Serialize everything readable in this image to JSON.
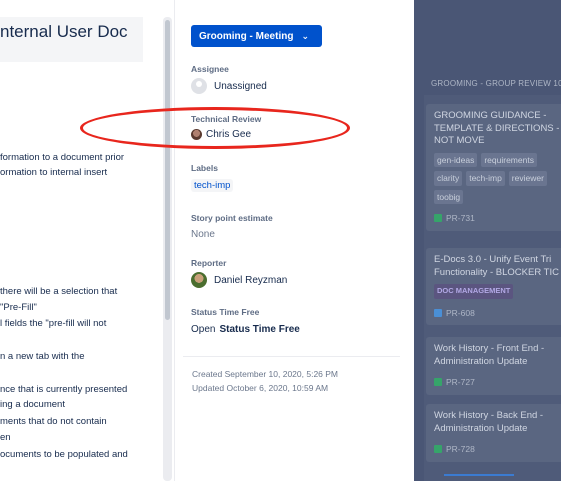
{
  "description": {
    "title": "nternal User Doc",
    "lines": [
      "formation to a document prior",
      "ormation to internal insert",
      "there will be a selection that",
      "\"Pre-Fill\"",
      "l fields the \"pre-fill will not",
      "n a new tab with the",
      "nce that is currently presented",
      "ing a document",
      "ments that do not contain",
      "en",
      "ocuments to be populated and"
    ]
  },
  "details": {
    "status_label": "Grooming - Meeting",
    "assignee_label": "Assignee",
    "assignee_value": "Unassigned",
    "technical_review_label": "Technical Review",
    "technical_review_value": "Chris Gee",
    "labels_label": "Labels",
    "labels_value": "tech-imp",
    "story_points_label": "Story point estimate",
    "story_points_value": "None",
    "reporter_label": "Reporter",
    "reporter_value": "Daniel Reyzman",
    "status_time_label": "Status Time Free",
    "status_time_prefix": "Open",
    "status_time_value": "Status Time Free",
    "created": "Created September 10, 2020, 5:26 PM",
    "updated": "Updated October 6, 2020, 10:59 AM"
  },
  "board": {
    "column_header": "GROOMING - GROUP REVIEW  10",
    "cards": [
      {
        "title": "GROOMING GUIDANCE -\nTEMPLATE & DIRECTIONS -\nNOT MOVE",
        "tags": [
          "gen-ideas",
          "requirements",
          "clarity",
          "tech-imp",
          "reviewer",
          "toobig"
        ],
        "key": "PR-731",
        "icon": "story-icon"
      },
      {
        "title": "E-Docs 3.0 - Unify Event Tri\nFunctionality - BLOCKER TIC",
        "epic": "DOC MANAGEMENT",
        "key": "PR-608",
        "icon": "task-icon"
      },
      {
        "title": "Work History - Front End -\nAdministration Update",
        "key": "PR-727",
        "icon": "story-icon"
      },
      {
        "title": "Work History - Back End -\nAdministration Update",
        "key": "PR-728",
        "icon": "story-icon"
      }
    ]
  },
  "colors": {
    "primary": "#0052cc",
    "annotation": "#e8261d",
    "overlay": "#4a5675"
  }
}
